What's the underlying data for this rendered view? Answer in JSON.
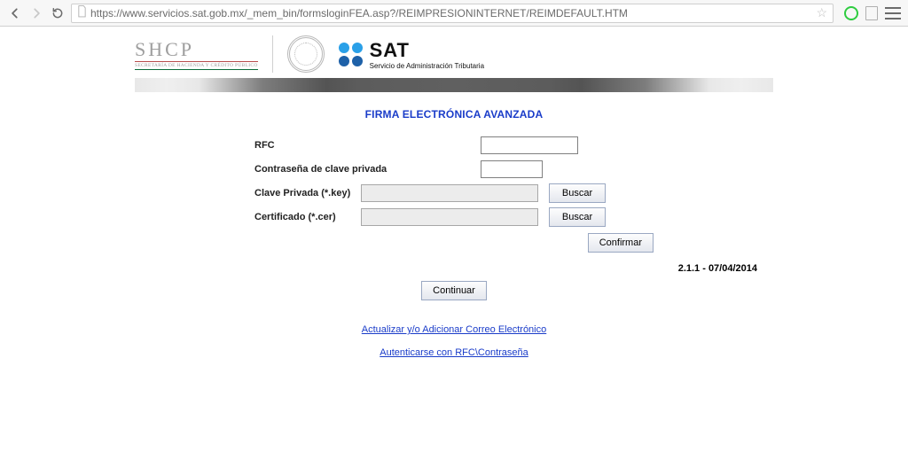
{
  "browser": {
    "url": "https://www.servicios.sat.gob.mx/_mem_bin/formsloginFEA.asp?/REIMPRESIONINTERNET/REIMDEFAULT.HTM"
  },
  "logos": {
    "shcp": {
      "main": "SHCP",
      "sub": "SECRETARÍA DE HACIENDA Y CRÉDITO PÚBLICO"
    },
    "sat": {
      "main": "SAT",
      "sub": "Servicio de Administración Tributaria"
    }
  },
  "page_title": "FIRMA ELECTRÓNICA AVANZADA",
  "form": {
    "rfc": {
      "label": "RFC",
      "value": ""
    },
    "password": {
      "label": "Contraseña de clave privada",
      "value": ""
    },
    "private_key": {
      "label": "Clave Privada (*.key)",
      "value": "",
      "browse": "Buscar"
    },
    "certificate": {
      "label": "Certificado (*.cer)",
      "value": "",
      "browse": "Buscar"
    },
    "confirm": "Confirmar",
    "continue": "Continuar"
  },
  "version": "2.1.1 - 07/04/2014",
  "links": {
    "update_email": "Actualizar y/o Adicionar Correo Electrónico",
    "auth_rfc": "Autenticarse con RFC\\Contraseña"
  }
}
